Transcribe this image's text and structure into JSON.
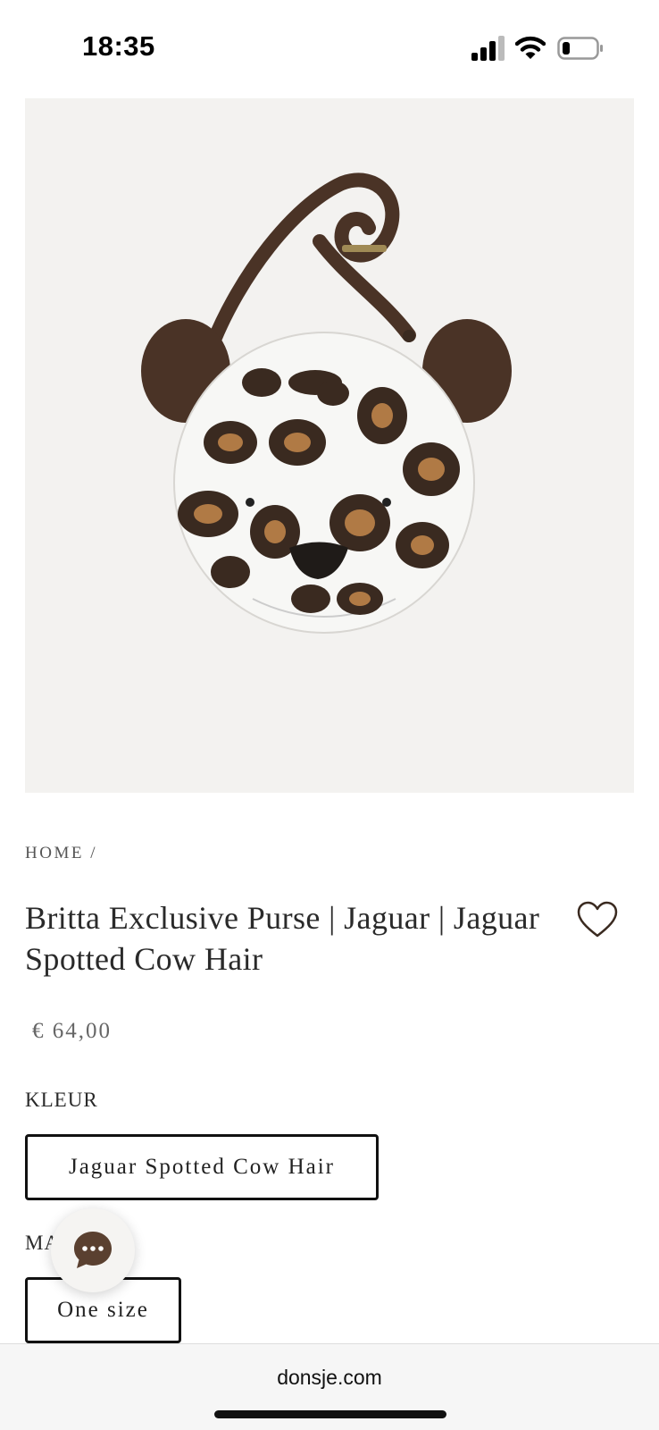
{
  "status_bar": {
    "time": "18:35",
    "icons": [
      "cellular-signal-icon",
      "wifi-icon",
      "battery-low-icon"
    ]
  },
  "product": {
    "image": "leopard-face-purse-image",
    "breadcrumb": "HOME /",
    "title": "Britta Exclusive Purse | Jaguar | Jaguar Spotted Cow Hair",
    "price": "€ 64,00",
    "wishlist_icon": "heart-outline-icon"
  },
  "options": {
    "color_label": "KLEUR",
    "color_value": "Jaguar Spotted Cow Hair",
    "size_label_visible": "MA",
    "size_value": "One size"
  },
  "chat": {
    "icon": "chat-bubble-icon",
    "color": "#5a4030"
  },
  "browser": {
    "url": "donsje.com"
  },
  "colors": {
    "accent_brown": "#4a3326",
    "image_background": "#f3f2f0"
  }
}
